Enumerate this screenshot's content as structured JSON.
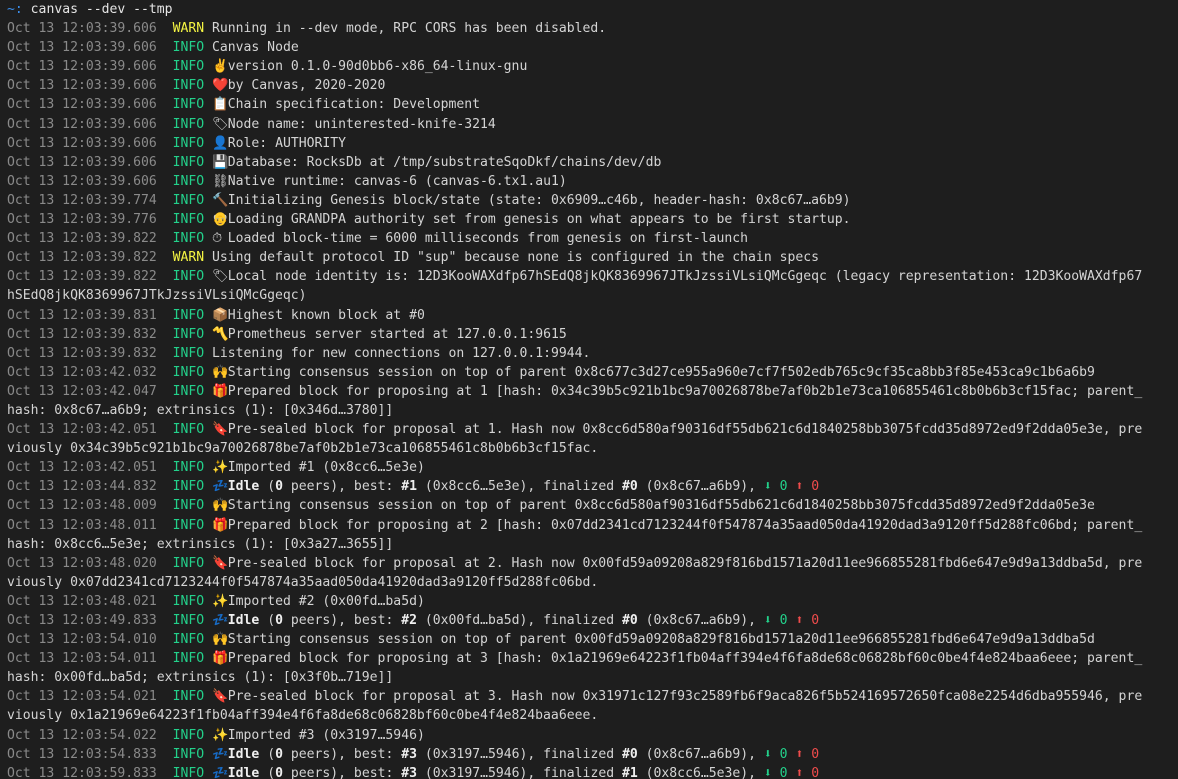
{
  "prompt": {
    "symbol": "~:",
    "command": "canvas --dev --tmp"
  },
  "colors": {
    "background": "#1e1e1e",
    "info": "#23d18b",
    "warn": "#f5f543",
    "timestamp": "#8a8a8a",
    "prompt": "#3b8eea",
    "down_arrow": "#23d18b",
    "up_arrow": "#f14c4c"
  },
  "lines": [
    {
      "ts": "Oct 13 12:03:39.606",
      "level": "WARN",
      "icon": "",
      "icon_name": "",
      "parts": [
        {
          "t": "Running in --dev mode, RPC CORS has been disabled."
        }
      ]
    },
    {
      "ts": "Oct 13 12:03:39.606",
      "level": "INFO",
      "icon": "",
      "icon_name": "",
      "parts": [
        {
          "t": "Canvas Node"
        }
      ]
    },
    {
      "ts": "Oct 13 12:03:39.606",
      "level": "INFO",
      "icon": "✌️",
      "icon_name": "victory-hand-icon",
      "parts": [
        {
          "t": "version 0.1.0-90d0bb6-x86_64-linux-gnu"
        }
      ]
    },
    {
      "ts": "Oct 13 12:03:39.606",
      "level": "INFO",
      "icon": "❤️",
      "icon_name": "heart-icon",
      "parts": [
        {
          "t": "by Canvas, 2020-2020"
        }
      ]
    },
    {
      "ts": "Oct 13 12:03:39.606",
      "level": "INFO",
      "icon": "📋",
      "icon_name": "clipboard-icon",
      "parts": [
        {
          "t": "Chain specification: Development"
        }
      ]
    },
    {
      "ts": "Oct 13 12:03:39.606",
      "level": "INFO",
      "icon": "🏷",
      "icon_name": "label-icon",
      "parts": [
        {
          "t": "Node name: uninterested-knife-3214"
        }
      ]
    },
    {
      "ts": "Oct 13 12:03:39.606",
      "level": "INFO",
      "icon": "👤",
      "icon_name": "user-icon",
      "parts": [
        {
          "t": "Role: AUTHORITY"
        }
      ]
    },
    {
      "ts": "Oct 13 12:03:39.606",
      "level": "INFO",
      "icon": "💾",
      "icon_name": "floppy-disk-icon",
      "parts": [
        {
          "t": "Database: RocksDb at /tmp/substrateSqoDkf/chains/dev/db"
        }
      ]
    },
    {
      "ts": "Oct 13 12:03:39.606",
      "level": "INFO",
      "icon": "⛓",
      "icon_name": "chains-icon",
      "parts": [
        {
          "t": "Native runtime: canvas-6 (canvas-6.tx1.au1)"
        }
      ]
    },
    {
      "ts": "Oct 13 12:03:39.774",
      "level": "INFO",
      "icon": "🔨",
      "icon_name": "hammer-icon",
      "parts": [
        {
          "t": "Initializing Genesis block/state (state: 0x6909…c46b, header-hash: 0x8c67…a6b9)"
        }
      ]
    },
    {
      "ts": "Oct 13 12:03:39.776",
      "level": "INFO",
      "icon": "👴",
      "icon_name": "old-man-icon",
      "parts": [
        {
          "t": "Loading GRANDPA authority set from genesis on what appears to be first startup."
        }
      ]
    },
    {
      "ts": "Oct 13 12:03:39.822",
      "level": "INFO",
      "icon": "⏱",
      "icon_name": "stopwatch-icon",
      "parts": [
        {
          "t": "Loaded block-time = 6000 milliseconds from genesis on first-launch"
        }
      ]
    },
    {
      "ts": "Oct 13 12:03:39.822",
      "level": "WARN",
      "icon": "",
      "icon_name": "",
      "parts": [
        {
          "t": "Using default protocol ID \"sup\" because none is configured in the chain specs"
        }
      ]
    },
    {
      "ts": "Oct 13 12:03:39.822",
      "level": "INFO",
      "icon": "🏷",
      "icon_name": "label-icon",
      "parts": [
        {
          "t": "Local node identity is: 12D3KooWAXdfp67hSEdQ8jkQK8369967JTkJzssiVLsiQMcGgeqc (legacy representation: 12D3KooWAXdfp67"
        }
      ]
    },
    {
      "cont": "hSEdQ8jkQK8369967JTkJzssiVLsiQMcGgeqc)"
    },
    {
      "ts": "Oct 13 12:03:39.831",
      "level": "INFO",
      "icon": "📦",
      "icon_name": "package-icon",
      "parts": [
        {
          "t": "Highest known block at #0"
        }
      ]
    },
    {
      "ts": "Oct 13 12:03:39.832",
      "level": "INFO",
      "icon": "〽️",
      "icon_name": "part-alternation-mark-icon",
      "parts": [
        {
          "t": "Prometheus server started at 127.0.0.1:9615"
        }
      ]
    },
    {
      "ts": "Oct 13 12:03:39.832",
      "level": "INFO",
      "icon": "",
      "icon_name": "",
      "parts": [
        {
          "t": "Listening for new connections on 127.0.0.1:9944."
        }
      ]
    },
    {
      "ts": "Oct 13 12:03:42.032",
      "level": "INFO",
      "icon": "🙌",
      "icon_name": "raised-hands-icon",
      "parts": [
        {
          "t": "Starting consensus session on top of parent 0x8c677c3d27ce955a960e7cf7f502edb765c9cf35ca8bb3f85e453ca9c1b6a6b9"
        }
      ]
    },
    {
      "ts": "Oct 13 12:03:42.047",
      "level": "INFO",
      "icon": "🎁",
      "icon_name": "gift-icon",
      "parts": [
        {
          "t": "Prepared block for proposing at 1 [hash: 0x34c39b5c921b1bc9a70026878be7af0b2b1e73ca106855461c8b0b6b3cf15fac; parent_"
        }
      ]
    },
    {
      "cont": "hash: 0x8c67…a6b9; extrinsics (1): [0x346d…3780]]"
    },
    {
      "ts": "Oct 13 12:03:42.051",
      "level": "INFO",
      "icon": "🔖",
      "icon_name": "bookmark-icon",
      "parts": [
        {
          "t": "Pre-sealed block for proposal at 1. Hash now 0x8cc6d580af90316df55db621c6d1840258bb3075fcdd35d8972ed9f2dda05e3e, pre"
        }
      ]
    },
    {
      "cont": "viously 0x34c39b5c921b1bc9a70026878be7af0b2b1e73ca106855461c8b0b6b3cf15fac."
    },
    {
      "ts": "Oct 13 12:03:42.051",
      "level": "INFO",
      "icon": "✨",
      "icon_name": "sparkles-icon",
      "parts": [
        {
          "t": "Imported #1 (0x8cc6…5e3e)"
        }
      ]
    },
    {
      "ts": "Oct 13 12:03:44.832",
      "level": "INFO",
      "icon": "💤",
      "icon_name": "zzz-icon",
      "parts": [
        {
          "t": "Idle",
          "b": true
        },
        {
          "t": " ("
        },
        {
          "t": "0",
          "b": true
        },
        {
          "t": " peers), best: "
        },
        {
          "t": "#1",
          "b": true
        },
        {
          "t": " (0x8cc6…5e3e), finalized "
        },
        {
          "t": "#0",
          "b": true
        },
        {
          "t": " (0x8c67…a6b9), "
        },
        {
          "t": "⬇ 0",
          "c": "dn"
        },
        {
          "t": " "
        },
        {
          "t": "⬆ 0",
          "c": "up"
        }
      ]
    },
    {
      "ts": "Oct 13 12:03:48.009",
      "level": "INFO",
      "icon": "🙌",
      "icon_name": "raised-hands-icon",
      "parts": [
        {
          "t": "Starting consensus session on top of parent 0x8cc6d580af90316df55db621c6d1840258bb3075fcdd35d8972ed9f2dda05e3e"
        }
      ]
    },
    {
      "ts": "Oct 13 12:03:48.011",
      "level": "INFO",
      "icon": "🎁",
      "icon_name": "gift-icon",
      "parts": [
        {
          "t": "Prepared block for proposing at 2 [hash: 0x07dd2341cd7123244f0f547874a35aad050da41920dad3a9120ff5d288fc06bd; parent_"
        }
      ]
    },
    {
      "cont": "hash: 0x8cc6…5e3e; extrinsics (1): [0x3a27…3655]]"
    },
    {
      "ts": "Oct 13 12:03:48.020",
      "level": "INFO",
      "icon": "🔖",
      "icon_name": "bookmark-icon",
      "parts": [
        {
          "t": "Pre-sealed block for proposal at 2. Hash now 0x00fd59a09208a829f816bd1571a20d11ee966855281fbd6e647e9d9a13ddba5d, pre"
        }
      ]
    },
    {
      "cont": "viously 0x07dd2341cd7123244f0f547874a35aad050da41920dad3a9120ff5d288fc06bd."
    },
    {
      "ts": "Oct 13 12:03:48.021",
      "level": "INFO",
      "icon": "✨",
      "icon_name": "sparkles-icon",
      "parts": [
        {
          "t": "Imported #2 (0x00fd…ba5d)"
        }
      ]
    },
    {
      "ts": "Oct 13 12:03:49.833",
      "level": "INFO",
      "icon": "💤",
      "icon_name": "zzz-icon",
      "parts": [
        {
          "t": "Idle",
          "b": true
        },
        {
          "t": " ("
        },
        {
          "t": "0",
          "b": true
        },
        {
          "t": " peers), best: "
        },
        {
          "t": "#2",
          "b": true
        },
        {
          "t": " (0x00fd…ba5d), finalized "
        },
        {
          "t": "#0",
          "b": true
        },
        {
          "t": " (0x8c67…a6b9), "
        },
        {
          "t": "⬇ 0",
          "c": "dn"
        },
        {
          "t": " "
        },
        {
          "t": "⬆ 0",
          "c": "up"
        }
      ]
    },
    {
      "ts": "Oct 13 12:03:54.010",
      "level": "INFO",
      "icon": "🙌",
      "icon_name": "raised-hands-icon",
      "parts": [
        {
          "t": "Starting consensus session on top of parent 0x00fd59a09208a829f816bd1571a20d11ee966855281fbd6e647e9d9a13ddba5d"
        }
      ]
    },
    {
      "ts": "Oct 13 12:03:54.011",
      "level": "INFO",
      "icon": "🎁",
      "icon_name": "gift-icon",
      "parts": [
        {
          "t": "Prepared block for proposing at 3 [hash: 0x1a21969e64223f1fb04aff394e4f6fa8de68c06828bf60c0be4f4e824baa6eee; parent_"
        }
      ]
    },
    {
      "cont": "hash: 0x00fd…ba5d; extrinsics (1): [0x3f0b…719e]]"
    },
    {
      "ts": "Oct 13 12:03:54.021",
      "level": "INFO",
      "icon": "🔖",
      "icon_name": "bookmark-icon",
      "parts": [
        {
          "t": "Pre-sealed block for proposal at 3. Hash now 0x31971c127f93c2589fb6f9aca826f5b524169572650fca08e2254d6dba955946, pre"
        }
      ]
    },
    {
      "cont": "viously 0x1a21969e64223f1fb04aff394e4f6fa8de68c06828bf60c0be4f4e824baa6eee."
    },
    {
      "ts": "Oct 13 12:03:54.022",
      "level": "INFO",
      "icon": "✨",
      "icon_name": "sparkles-icon",
      "parts": [
        {
          "t": "Imported #3 (0x3197…5946)"
        }
      ]
    },
    {
      "ts": "Oct 13 12:03:54.833",
      "level": "INFO",
      "icon": "💤",
      "icon_name": "zzz-icon",
      "parts": [
        {
          "t": "Idle",
          "b": true
        },
        {
          "t": " ("
        },
        {
          "t": "0",
          "b": true
        },
        {
          "t": " peers), best: "
        },
        {
          "t": "#3",
          "b": true
        },
        {
          "t": " (0x3197…5946), finalized "
        },
        {
          "t": "#0",
          "b": true
        },
        {
          "t": " (0x8c67…a6b9), "
        },
        {
          "t": "⬇ 0",
          "c": "dn"
        },
        {
          "t": " "
        },
        {
          "t": "⬆ 0",
          "c": "up"
        }
      ]
    },
    {
      "ts": "Oct 13 12:03:59.833",
      "level": "INFO",
      "icon": "💤",
      "icon_name": "zzz-icon",
      "parts": [
        {
          "t": "Idle",
          "b": true
        },
        {
          "t": " ("
        },
        {
          "t": "0",
          "b": true
        },
        {
          "t": " peers), best: "
        },
        {
          "t": "#3",
          "b": true
        },
        {
          "t": " (0x3197…5946), finalized "
        },
        {
          "t": "#1",
          "b": true
        },
        {
          "t": " (0x8cc6…5e3e), "
        },
        {
          "t": "⬇ 0",
          "c": "dn"
        },
        {
          "t": " "
        },
        {
          "t": "⬆ 0",
          "c": "up"
        }
      ]
    }
  ]
}
